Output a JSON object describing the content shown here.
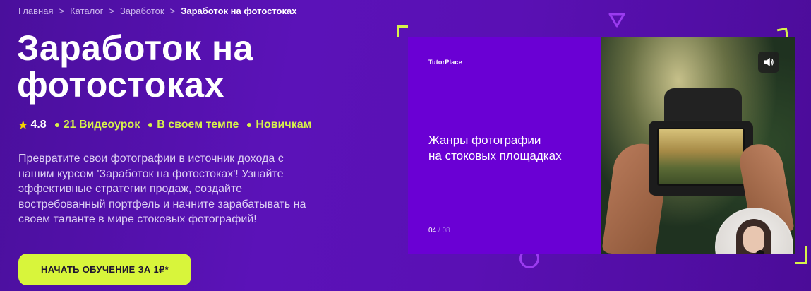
{
  "breadcrumb": {
    "items": [
      "Главная",
      "Каталог",
      "Заработок"
    ],
    "separator": ">",
    "current": "Заработок на фотостоках"
  },
  "title": {
    "line1": "Заработок на",
    "line2": "фотостоках"
  },
  "meta": {
    "rating": "4.8",
    "lessons": "21 Видеоурок",
    "pace": "В своем темпе",
    "level": "Новичкам"
  },
  "description": "Превратите свои фотографии в источник дохода с нашим курсом 'Заработок на фотостоках'! Узнайте эффективные стратегии продаж, создайте востребованный портфель и начните зарабатывать на своем таланте в мире стоковых фотографий!",
  "cta_label": "НАЧАТЬ ОБУЧЕНИЕ ЗА 1₽*",
  "video": {
    "logo": "TutorPlace",
    "slide_title_line1": "Жанры фотографии",
    "slide_title_line2": "на стоковых площадках",
    "slide_current": "04",
    "slide_separator": "/",
    "slide_total": "08",
    "mute_icon": "speaker-icon"
  },
  "colors": {
    "accent": "#d8f53b",
    "background": "#5a10b4",
    "slide_bg": "#6a00d4"
  }
}
